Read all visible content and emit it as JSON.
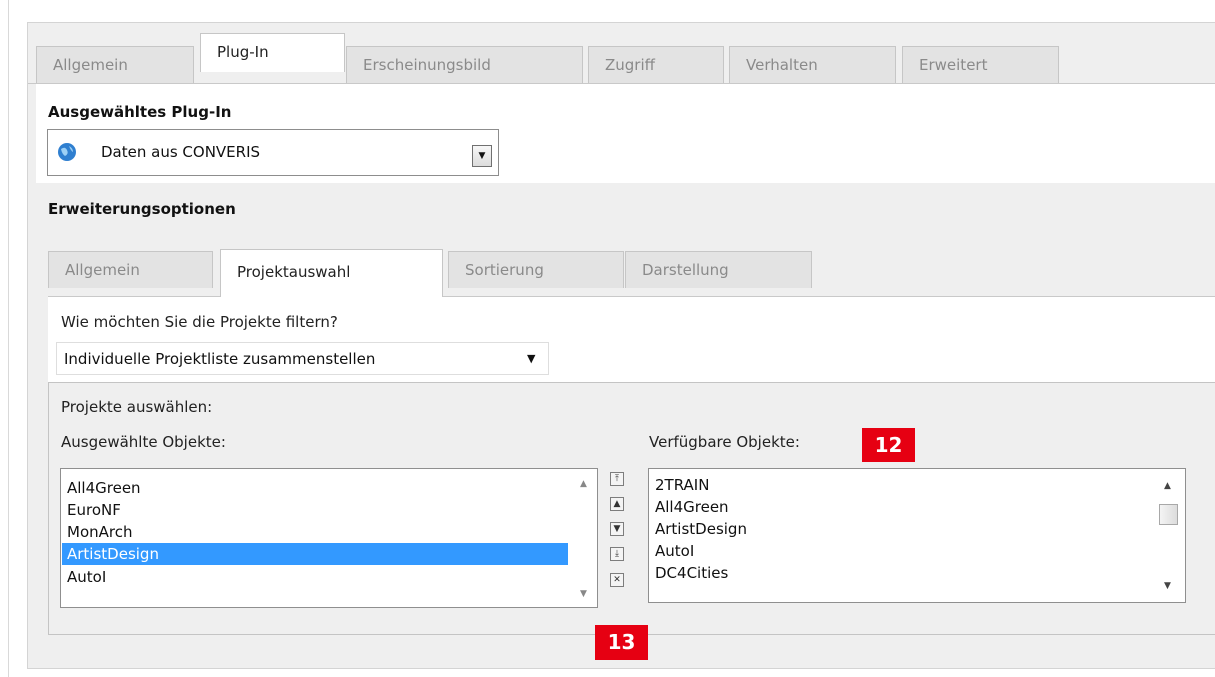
{
  "outer_tabs": [
    "Allgemein",
    "Plug-In",
    "Erscheinungsbild",
    "Zugriff",
    "Verhalten",
    "Erweitert"
  ],
  "plugin": {
    "heading": "Ausgewähltes Plug-In",
    "selected": "Daten aus CONVERIS",
    "dropdown_icon": "triangle-down"
  },
  "extension": {
    "heading": "Erweiterungsoptionen",
    "tabs": [
      "Allgemein",
      "Projektauswahl",
      "Sortierung",
      "Darstellung"
    ]
  },
  "filter": {
    "question": "Wie möchten Sie die Projekte filtern?",
    "selected": "Individuelle Projektliste zusammenstellen"
  },
  "projects": {
    "label": "Projekte auswählen:",
    "selected_label": "Ausgewählte Objekte:",
    "available_label": "Verfügbare Objekte:",
    "selected_items": [
      "All4Green",
      "EuroNF",
      "MonArch",
      "ArtistDesign",
      "AutoI"
    ],
    "highlighted": "ArtistDesign",
    "available_items": [
      "2TRAIN",
      "All4Green",
      "ArtistDesign",
      "AutoI",
      "DC4Cities"
    ],
    "move_buttons": [
      "move-top",
      "move-up",
      "move-down",
      "move-bottom",
      "remove"
    ]
  },
  "badges": [
    "12",
    "13"
  ],
  "colors": {
    "highlight": "#3399ff",
    "badge": "#e60012"
  }
}
